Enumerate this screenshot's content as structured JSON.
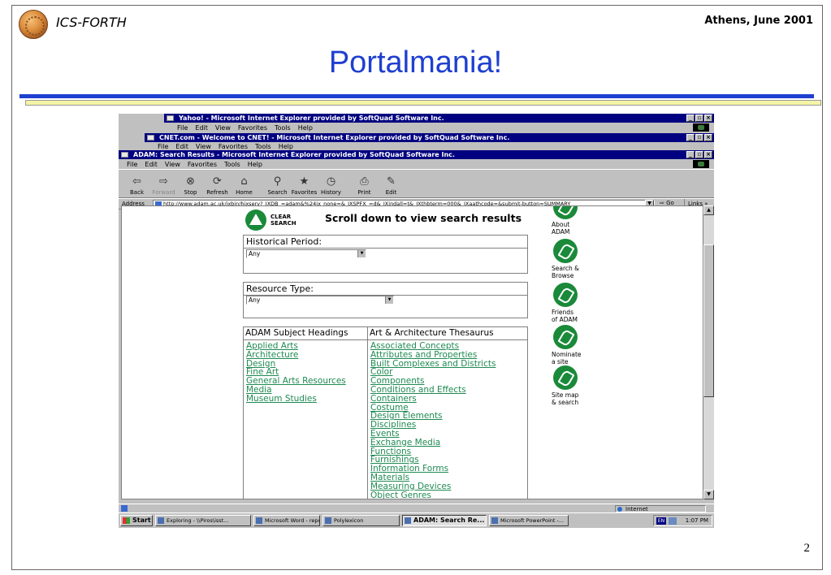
{
  "slide": {
    "org": "ICS-FORTH",
    "place_date": "Athens, June 2001",
    "title": "Portalmania!",
    "page_number": "2"
  },
  "windows": {
    "yahoo": {
      "title": "Yahoo! - Microsoft Internet Explorer provided by SoftQuad Software Inc."
    },
    "cnet": {
      "title": "CNET.com - Welcome to CNET! - Microsoft Internet Explorer provided by SoftQuad Software Inc."
    },
    "adam": {
      "title": "ADAM: Search Results - Microsoft Internet Explorer provided by SoftQuad Software Inc."
    }
  },
  "menu": [
    "File",
    "Edit",
    "View",
    "Favorites",
    "Tools",
    "Help"
  ],
  "menu_partial": [
    "File",
    "Edit",
    "View",
    "Favorites",
    "Tools",
    "Help"
  ],
  "toolbar": {
    "back": "Back",
    "forward": "Forward",
    "stop": "Stop",
    "refresh": "Refresh",
    "home": "Home",
    "search": "Search",
    "favorites": "Favorites",
    "history": "History",
    "print": "Print",
    "edit": "Edit"
  },
  "addressbar": {
    "label": "Address",
    "url": "http://www.adam.ac.uk/ixbin/hixserv?_IXDB_=adam&%24ix_none=&_IXSPFX_=d&_IXindall=t&_IXthbterm=000&_IXaathcode=&submit-button=SUMMARY",
    "go": "Go",
    "links": "Links »"
  },
  "page": {
    "clear_search": [
      "CLEAR",
      "SEARCH"
    ],
    "scroll_message": "Scroll down to view search results",
    "historical_period": {
      "label": "Historical Period:",
      "value": "Any"
    },
    "resource_type": {
      "label": "Resource Type:",
      "value": "Any"
    },
    "subject_headings": {
      "label": "ADAM Subject Headings",
      "items": [
        "Applied Arts",
        "Architecture",
        "Design",
        "Fine Art",
        "General Arts Resources",
        "Media",
        "Museum Studies"
      ]
    },
    "thesaurus": {
      "label": "Art & Architecture Thesaurus",
      "items": [
        "Associated Concepts",
        "Attributes and Properties",
        "Built Complexes and Districts",
        "Color",
        "Components",
        "Conditions and Effects",
        "Containers",
        "Costume",
        "Design Elements",
        "Disciplines",
        "Events",
        "Exchange Media",
        "Functions",
        "Furnishings",
        "Information Forms",
        "Materials",
        "Measuring Devices",
        "Object Genres"
      ]
    },
    "side_nav": [
      {
        "line1": "About",
        "line2": "ADAM"
      },
      {
        "line1": "Search &",
        "line2": "Browse"
      },
      {
        "line1": "Friends",
        "line2": "of ADAM"
      },
      {
        "line1": "Nominate",
        "line2": "a site"
      },
      {
        "line1": "Site map",
        "line2": "& search"
      }
    ]
  },
  "status": {
    "zone": "Internet"
  },
  "taskbar": {
    "start": "Start",
    "tasks": [
      "Exploring - \\\\Piros\\isst...",
      "Microsoft Word - repor...",
      "Polylexicon",
      "ADAM: Search Re...",
      "Microsoft PowerPoint -..."
    ],
    "lang": "EN",
    "clock": "1:07 PM"
  }
}
